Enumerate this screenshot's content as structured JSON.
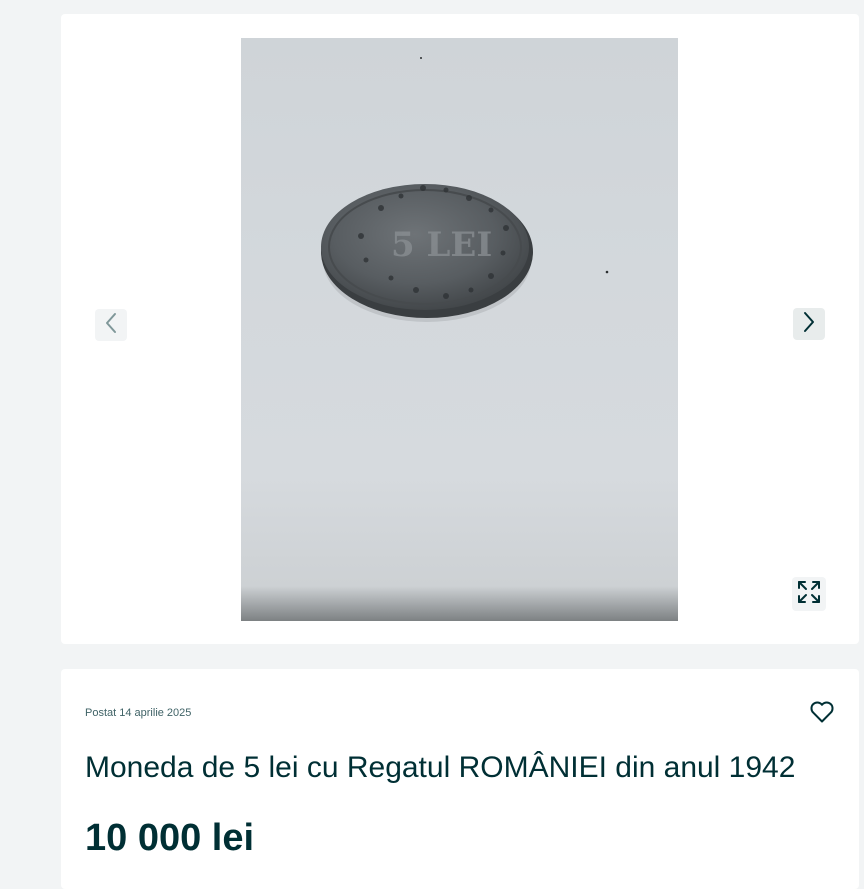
{
  "gallery": {
    "prev_icon": "chevron-left-icon",
    "next_icon": "chevron-right-icon",
    "expand_icon": "expand-icon",
    "photo_text": "5 LEI"
  },
  "listing": {
    "posted": "Postat 14 aprilie 2025",
    "title": "Moneda de 5 lei cu Regatul ROMÂNIEI din anul 1942",
    "price": "10 000 lei",
    "favorite_icon": "heart-icon"
  },
  "colors": {
    "page_background": "#f2f4f5",
    "card_background": "#ffffff",
    "text_primary": "#002f34"
  }
}
